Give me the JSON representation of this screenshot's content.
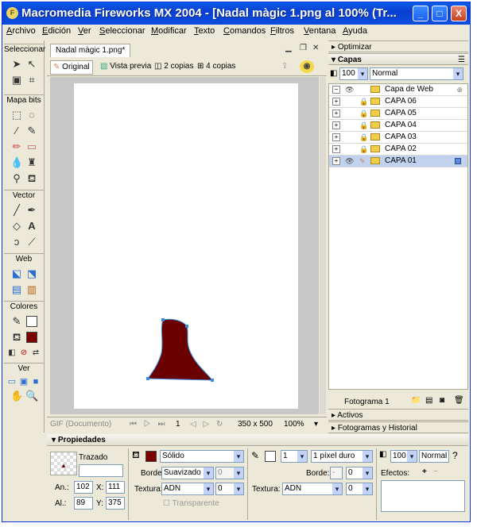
{
  "window": {
    "title": "Macromedia Fireworks MX 2004 - [Nadal màgic 1.png al 100% (Tr...",
    "buttons": {
      "minimize": "_",
      "maximize": "□",
      "close": "X"
    }
  },
  "menu": [
    "Archivo",
    "Edición",
    "Ver",
    "Seleccionar",
    "Modificar",
    "Texto",
    "Comandos",
    "Filtros",
    "Ventana",
    "Ayuda"
  ],
  "tools": {
    "sections": [
      "Seleccionar",
      "Mapa bits",
      "Vector",
      "Web",
      "Colores",
      "Ver"
    ],
    "colors": {
      "stroke": "#ffffff",
      "fill": "#7a0000"
    }
  },
  "document": {
    "tab": "Nadal màgic 1.png*",
    "views": [
      "Original",
      "Vista previa",
      "2 copias",
      "4 copias"
    ],
    "status": {
      "format": "GIF (Documento)",
      "frame": "1",
      "size": "350 x 500",
      "zoom": "100%"
    },
    "shape_color": "#6b0000"
  },
  "panels": {
    "optimize": "Optimizar",
    "layers": {
      "title": "Capas",
      "opacity": "100",
      "blend": "Normal",
      "rows": [
        {
          "name": "Capa de Web",
          "selected": false
        },
        {
          "name": "CAPA 06",
          "selected": false
        },
        {
          "name": "CAPA 05",
          "selected": false
        },
        {
          "name": "CAPA 04",
          "selected": false
        },
        {
          "name": "CAPA 03",
          "selected": false
        },
        {
          "name": "CAPA 02",
          "selected": false
        },
        {
          "name": "CAPA 01",
          "selected": true
        }
      ],
      "footer": "Fotograma 1"
    },
    "assets": "Activos",
    "frames": "Fotogramas y Historial"
  },
  "properties": {
    "title": "Propiedades",
    "object": "Trazado",
    "an": "102",
    "x": "111",
    "al": "89",
    "y": "375",
    "fill_type": "Sólido",
    "edge_label": "Borde:",
    "edge": "Suavizado",
    "edge_amount": "0",
    "texture_label": "Textura:",
    "texture": "ADN",
    "texture_amount": "0",
    "transparent": "Transparente",
    "stroke_size": "1",
    "stroke_type": "1 píxel duro",
    "stroke_edge_label": "Borde:",
    "stroke_edge": "-",
    "stroke_edge_amount": "0",
    "stroke_texture_label": "Textura:",
    "stroke_texture": "ADN",
    "stroke_texture_amount": "0",
    "opacity": "100",
    "blend": "Normal",
    "effects_label": "Efectos:"
  }
}
